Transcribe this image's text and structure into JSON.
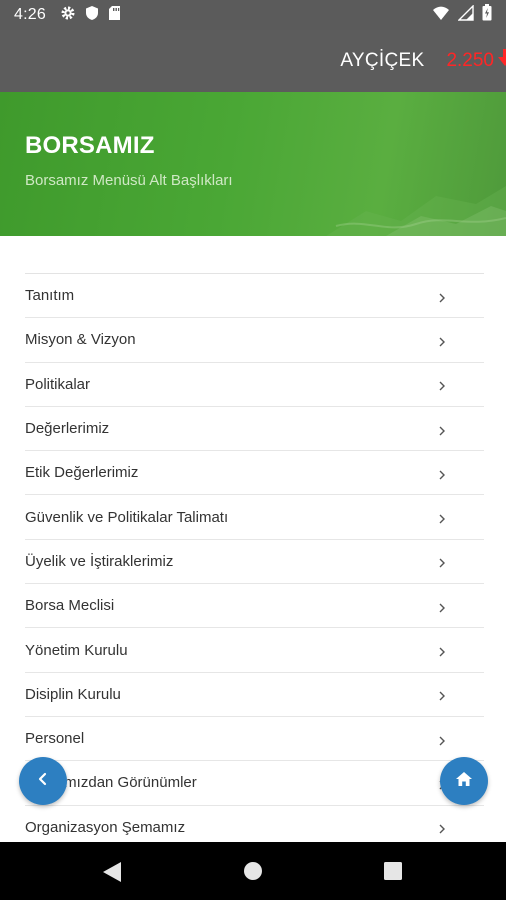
{
  "status_bar": {
    "time": "4:26",
    "icons": [
      "gear-icon",
      "shield-icon",
      "sd-card-icon"
    ],
    "right_icons": [
      "wifi-icon",
      "signal-icon",
      "battery-icon"
    ]
  },
  "app_bar": {
    "ticker_name": "AYÇİÇEK",
    "ticker_price": "2.250",
    "ticker_trend": "down-arrow-icon",
    "price_color": "#ff2626"
  },
  "hero": {
    "title": "BORSAMIZ",
    "subtitle": "Borsamız Menüsü Alt Başlıkları"
  },
  "menu": {
    "items": [
      {
        "label": "Tanıtım"
      },
      {
        "label": "Misyon & Vizyon"
      },
      {
        "label": "Politikalar"
      },
      {
        "label": "Değerlerimiz"
      },
      {
        "label": "Etik Değerlerimiz"
      },
      {
        "label": "Güvenlik ve Politikalar Talimatı"
      },
      {
        "label": "Üyelik ve İştiraklerimiz"
      },
      {
        "label": "Borsa Meclisi"
      },
      {
        "label": "Yönetim Kurulu"
      },
      {
        "label": "Disiplin Kurulu"
      },
      {
        "label": "Personel"
      },
      {
        "label": "Borsamızdan Görünümler"
      },
      {
        "label": "Organizasyon Şemamız"
      }
    ]
  },
  "fabs": {
    "back_icon": "chevron-left-icon",
    "home_icon": "home-icon",
    "color": "#2d7fc1"
  },
  "nav_bar": {
    "buttons": [
      "back-triangle-icon",
      "home-circle-icon",
      "recents-square-icon"
    ]
  },
  "colors": {
    "header_bg": "#5c5c5c",
    "hero_green": "#4aa735",
    "text_primary": "#333333"
  }
}
